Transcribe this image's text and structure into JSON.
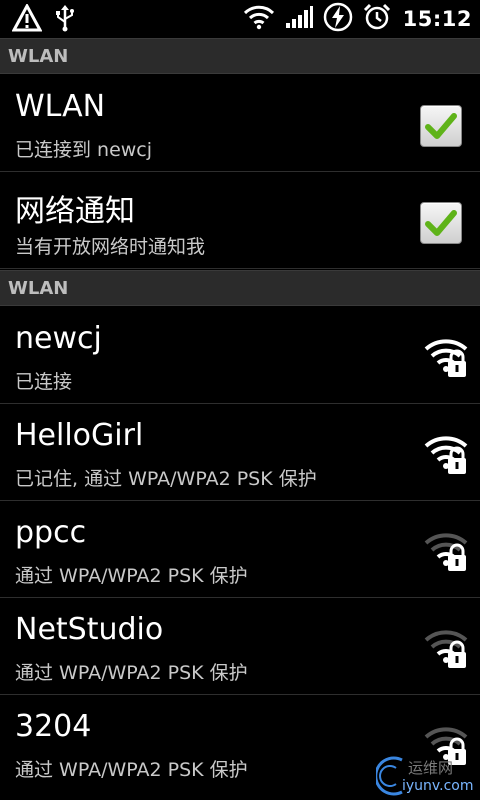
{
  "status_bar": {
    "icons_left": [
      "warning-icon",
      "usb-icon"
    ],
    "icons_right": [
      "wifi-signal-icon",
      "cell-signal-icon",
      "battery-charging-icon",
      "alarm-icon"
    ],
    "time": "15:12"
  },
  "sections": [
    {
      "header": "WLAN",
      "rows": [
        {
          "title": "WLAN",
          "subtitle": "已连接到 newcj",
          "checked": true
        },
        {
          "title": "网络通知",
          "subtitle": "当有开放网络时通知我",
          "checked": true
        }
      ]
    },
    {
      "header": "WLAN",
      "networks": [
        {
          "ssid": "newcj",
          "status": "已连接",
          "signal": "strong",
          "locked": true
        },
        {
          "ssid": "HelloGirl",
          "status": "已记住, 通过 WPA/WPA2 PSK 保护",
          "signal": "strong",
          "locked": true
        },
        {
          "ssid": "ppcc",
          "status": "通过 WPA/WPA2 PSK 保护",
          "signal": "weak",
          "locked": true
        },
        {
          "ssid": "NetStudio",
          "status": "通过 WPA/WPA2 PSK 保护",
          "signal": "weak",
          "locked": true
        },
        {
          "ssid": "3204",
          "status": "通过 WPA/WPA2 PSK 保护",
          "signal": "weak",
          "locked": true
        }
      ]
    }
  ],
  "watermark": {
    "text": "运维网",
    "url": "iyunv.com"
  },
  "colors": {
    "background": "#000000",
    "section_header": "#2b2b2b",
    "check_green": "#5fb319"
  }
}
